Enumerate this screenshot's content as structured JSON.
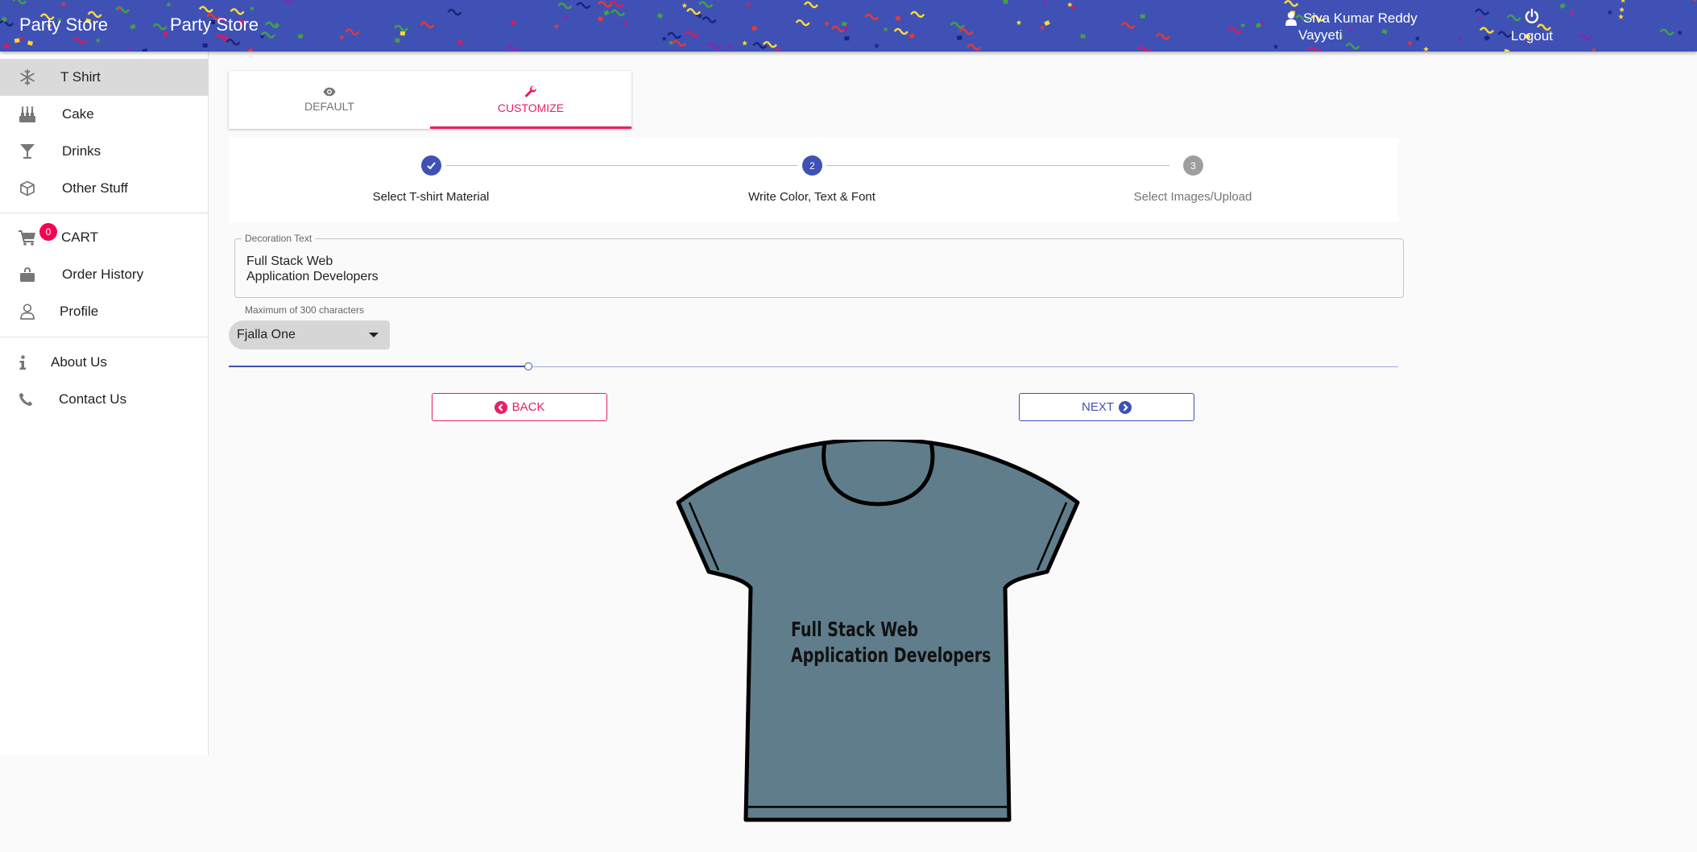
{
  "header": {
    "brand_left": "Party Store",
    "brand_right": "Party Store",
    "user_name_line1": "Siva Kumar Reddy",
    "user_name_line2": "Vayyeti",
    "logout_label": "Logout",
    "bg_color": "#3f51b5"
  },
  "sidebar": {
    "items": [
      {
        "label": "T Shirt",
        "icon": "snowflake-icon"
      },
      {
        "label": "Cake",
        "icon": "cake-icon"
      },
      {
        "label": "Drinks",
        "icon": "cocktail-icon"
      },
      {
        "label": "Other Stuff",
        "icon": "box-icon"
      },
      {
        "label": "CART",
        "icon": "cart-icon"
      },
      {
        "label": "Order History",
        "icon": "shopping-bag-icon"
      },
      {
        "label": "Profile",
        "icon": "user-icon"
      },
      {
        "label": "About Us",
        "icon": "info-icon"
      },
      {
        "label": "Contact Us",
        "icon": "phone-icon"
      }
    ],
    "cart_count": "0",
    "active": "T Shirt"
  },
  "tabs": [
    {
      "label": "DEFAULT",
      "icon": "eye-icon"
    },
    {
      "label": "CUSTOMIZE",
      "icon": "wrench-icon"
    }
  ],
  "stepper": {
    "steps": [
      {
        "label": "Select T-shirt Material",
        "state": "completed"
      },
      {
        "label": "Write Color, Text & Font",
        "number": "2",
        "state": "active"
      },
      {
        "label": "Select Images/Upload",
        "number": "3",
        "state": "pending"
      }
    ]
  },
  "decoration": {
    "legend": "Decoration Text",
    "value": "Full Stack Web\nApplication Developers",
    "helper": "Maximum of 300 characters"
  },
  "font_select": {
    "value": "Fjalla One"
  },
  "slider": {
    "value_fraction": 0.256
  },
  "buttons": {
    "back": "BACK",
    "next": "NEXT"
  },
  "shirt": {
    "line1": "Full Stack Web",
    "line2": "Application Developers",
    "color": "#607d8b"
  },
  "colors": {
    "primary": "#3f51b5",
    "secondary": "#e91e63",
    "badge": "#f50057"
  }
}
